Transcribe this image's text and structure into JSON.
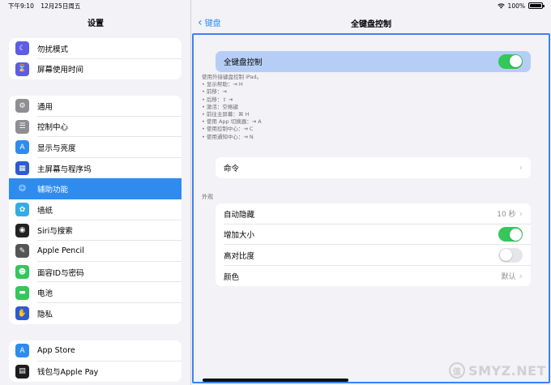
{
  "status": {
    "time": "下午9:10",
    "date": "12月25日周五",
    "battery": "100%"
  },
  "sidebar": {
    "title": "设置",
    "group1": [
      {
        "label": "勿扰模式",
        "icon": "moon-icon",
        "color": "#5e5ce6",
        "glyph": "☾"
      },
      {
        "label": "屏幕使用时间",
        "icon": "hourglass-icon",
        "color": "#5e5ce6",
        "glyph": "⌛"
      }
    ],
    "group2": [
      {
        "label": "通用",
        "icon": "gear-icon",
        "color": "#8e8e93",
        "glyph": "⚙"
      },
      {
        "label": "控制中心",
        "icon": "sliders-icon",
        "color": "#8e8e93",
        "glyph": "☰"
      },
      {
        "label": "显示与亮度",
        "icon": "text-size-icon",
        "color": "#2e8cf0",
        "glyph": "A"
      },
      {
        "label": "主屏幕与程序坞",
        "icon": "grid-icon",
        "color": "#2e5bd4",
        "glyph": "▦"
      },
      {
        "label": "辅助功能",
        "icon": "accessibility-icon",
        "color": "#2e8cf0",
        "glyph": "☺"
      },
      {
        "label": "墙纸",
        "icon": "flower-icon",
        "color": "#32ade6",
        "glyph": "✿"
      },
      {
        "label": "Siri与搜索",
        "icon": "siri-icon",
        "color": "#222222",
        "glyph": "◉"
      },
      {
        "label": "Apple Pencil",
        "icon": "pencil-icon",
        "color": "#555555",
        "glyph": "✎"
      },
      {
        "label": "面容ID与密码",
        "icon": "faceid-icon",
        "color": "#34c759",
        "glyph": "☻"
      },
      {
        "label": "电池",
        "icon": "battery-icon",
        "color": "#34c759",
        "glyph": "▬"
      },
      {
        "label": "隐私",
        "icon": "hand-icon",
        "color": "#2e5bd4",
        "glyph": "✋"
      }
    ],
    "group3": [
      {
        "label": "App Store",
        "icon": "appstore-icon",
        "color": "#2e8cf0",
        "glyph": "A"
      },
      {
        "label": "钱包与Apple Pay",
        "icon": "wallet-icon",
        "color": "#1c1c1e",
        "glyph": "▤"
      }
    ]
  },
  "detail": {
    "back_label": "键盘",
    "title": "全键盘控制",
    "main_toggle": {
      "label": "全键盘控制",
      "on": true
    },
    "description": [
      "使用外接键盘控制 iPad。",
      "• 显示帮助：⇥ H",
      "• 前移：⇥",
      "• 后移：⇧ ⇥",
      "• 激活：空格键",
      "• 前往主屏幕：⌘ H",
      "• 使用 App 切换器：⇥ A",
      "• 使用控制中心：⇥ C",
      "• 使用通知中心：⇥ N"
    ],
    "commands_label": "命令",
    "appearance_header": "外观",
    "appearance": {
      "auto_hide_label": "自动隐藏",
      "auto_hide_value": "10 秒",
      "bigger_label": "增加大小",
      "bigger_on": true,
      "contrast_label": "高对比度",
      "contrast_on": false,
      "color_label": "颜色",
      "color_value": "默认"
    }
  },
  "watermark": {
    "text": "SMYZ.NET",
    "glyph": "值"
  }
}
